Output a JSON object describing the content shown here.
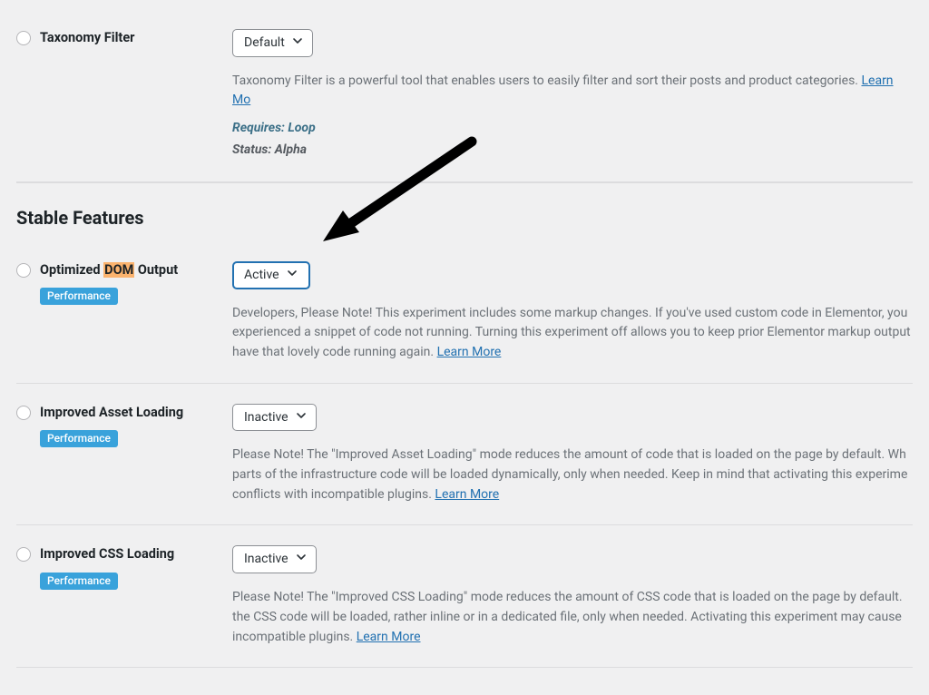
{
  "features": {
    "taxonomy_filter": {
      "label": "Taxonomy Filter",
      "select_value": "Default",
      "desc": "Taxonomy Filter is a powerful tool that enables users to easily filter and sort their posts and product categories. ",
      "learn_more": "Learn Mo",
      "requires_label": "Requires: Loop",
      "status_label": "Status: Alpha"
    }
  },
  "stable_heading": "Stable Features",
  "stable": {
    "optimized_dom": {
      "label_pre": "Optimized ",
      "label_hl": "DOM",
      "label_post": " Output",
      "badge": "Performance",
      "select_value": "Active",
      "desc": "Developers, Please Note! This experiment includes some markup changes. If you've used custom code in Elementor, you experienced a snippet of code not running. Turning this experiment off allows you to keep prior Elementor markup output have that lovely code running again. ",
      "learn_more": "Learn More"
    },
    "asset_loading": {
      "label": "Improved Asset Loading",
      "badge": "Performance",
      "select_value": "Inactive",
      "desc": "Please Note! The \"Improved Asset Loading\" mode reduces the amount of code that is loaded on the page by default. Wh parts of the infrastructure code will be loaded dynamically, only when needed. Keep in mind that activating this experime conflicts with incompatible plugins. ",
      "learn_more": "Learn More"
    },
    "css_loading": {
      "label": "Improved CSS Loading",
      "badge": "Performance",
      "select_value": "Inactive",
      "desc": "Please Note! The \"Improved CSS Loading\" mode reduces the amount of CSS code that is loaded on the page by default. the CSS code will be loaded, rather inline or in a dedicated file, only when needed. Activating this experiment may cause incompatible plugins. ",
      "learn_more": "Learn More"
    }
  }
}
